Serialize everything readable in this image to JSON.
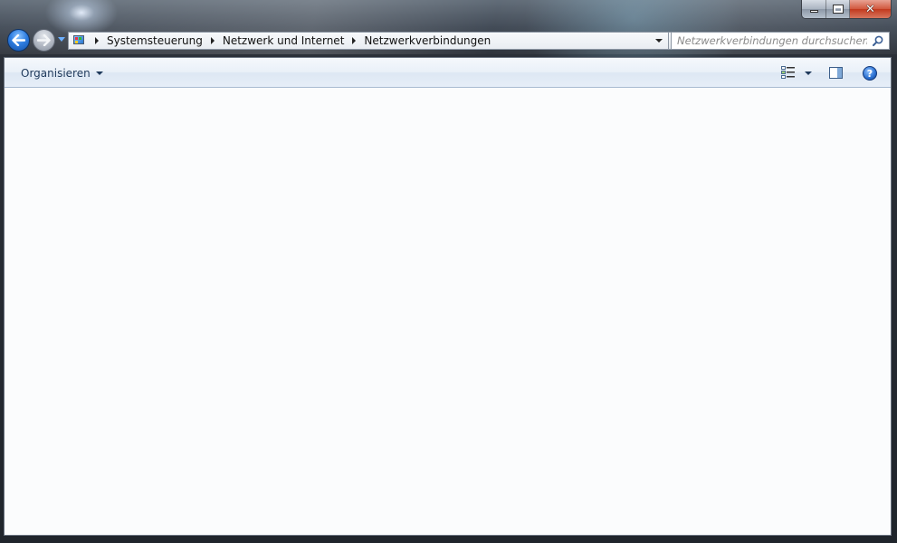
{
  "window": {
    "minimize_label": "",
    "maximize_label": "",
    "close_label": "✕"
  },
  "nav": {
    "back_icon": "back-arrow-icon",
    "forward_icon": "forward-arrow-icon"
  },
  "address": {
    "breadcrumbs": [
      "Systemsteuerung",
      "Netzwerk und Internet",
      "Netzwerkverbindungen"
    ]
  },
  "search": {
    "placeholder": "Netzwerkverbindungen durchsuchen",
    "value": ""
  },
  "toolbar": {
    "organize_label": "Organisieren",
    "help_label": "?"
  },
  "colors": {
    "accent": "#1e395b",
    "close_button": "#c2391e"
  }
}
